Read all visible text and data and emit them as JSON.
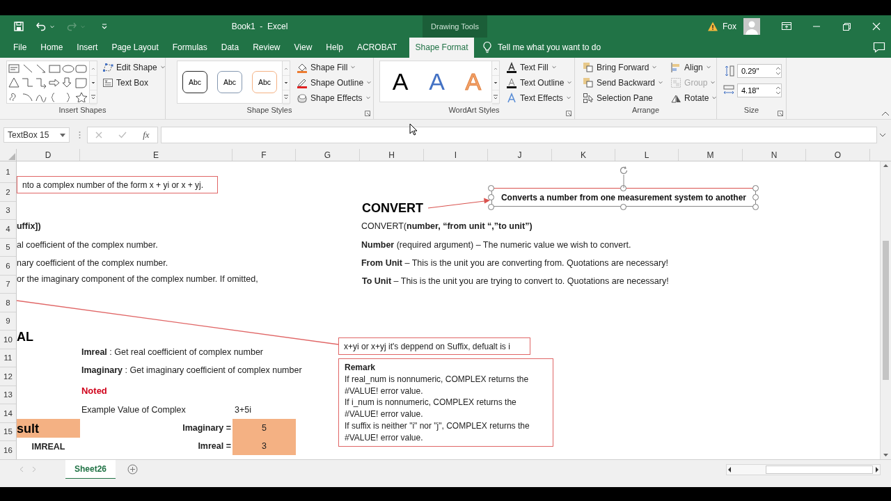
{
  "window": {
    "title": "Book1  -  Excel",
    "context_label": "Drawing Tools",
    "user": "Fox"
  },
  "tabs": [
    {
      "label": "File",
      "selected": false
    },
    {
      "label": "Home",
      "selected": false
    },
    {
      "label": "Insert",
      "selected": false
    },
    {
      "label": "Page Layout",
      "selected": false
    },
    {
      "label": "Formulas",
      "selected": false
    },
    {
      "label": "Data",
      "selected": false
    },
    {
      "label": "Review",
      "selected": false
    },
    {
      "label": "View",
      "selected": false
    },
    {
      "label": "Help",
      "selected": false
    },
    {
      "label": "ACROBAT",
      "selected": false
    },
    {
      "label": "Shape Format",
      "selected": true
    }
  ],
  "tell_me": "Tell me what you want to do",
  "ribbon": {
    "insert_shapes": {
      "title": "Insert Shapes",
      "buttons": [
        "Edit Shape",
        "Text Box"
      ]
    },
    "shape_styles": {
      "title": "Shape Styles",
      "presets": [
        {
          "label": "Abc",
          "color": "#262626"
        },
        {
          "label": "Abc",
          "color": "#8497b0"
        },
        {
          "label": "Abc",
          "color": "#f4b183"
        }
      ],
      "buttons": [
        "Shape Fill",
        "Shape Outline",
        "Shape Effects"
      ]
    },
    "wordart_styles": {
      "title": "WordArt Styles",
      "presets": [
        {
          "label": "A",
          "color": "#000000",
          "kind": "fill"
        },
        {
          "label": "A",
          "color": "#4472c4",
          "kind": "fill"
        },
        {
          "label": "A",
          "color": "#f4a46c",
          "kind": "outline"
        }
      ],
      "buttons": [
        "Text Fill",
        "Text Outline",
        "Text Effects"
      ]
    },
    "arrange": {
      "title": "Arrange",
      "buttons": [
        {
          "label": "Bring Forward",
          "disabled": false
        },
        {
          "label": "Send Backward",
          "disabled": false
        },
        {
          "label": "Selection Pane",
          "disabled": false
        },
        {
          "label": "Align",
          "disabled": false
        },
        {
          "label": "Group",
          "disabled": true
        },
        {
          "label": "Rotate",
          "disabled": false
        }
      ]
    },
    "size": {
      "title": "Size",
      "height": "0.29\"",
      "width": "4.18\""
    }
  },
  "formula_bar": {
    "name_box": "TextBox 15",
    "function_label": "fx"
  },
  "columns": [
    "D",
    "E",
    "F",
    "G",
    "H",
    "I",
    "J",
    "K",
    "L",
    "M",
    "N",
    "O"
  ],
  "rows": [
    "1",
    "2",
    "3",
    "4",
    "5",
    "6",
    "7",
    "8",
    "9",
    "10",
    "11",
    "12",
    "13",
    "14",
    "15",
    "16"
  ],
  "sheet": {
    "items": [
      {
        "kind": "callout",
        "text": "nto a complex number of the form x + yi or x + yj."
      },
      {
        "kind": "text",
        "text": "**uffix])**"
      },
      {
        "kind": "text",
        "text": "al coefficient of the complex number."
      },
      {
        "kind": "text",
        "text": "nary coefficient of the complex number."
      },
      {
        "kind": "text",
        "text": "or the imaginary component of the complex number. If omitted,"
      },
      {
        "kind": "heading",
        "text": "**AL**"
      },
      {
        "kind": "text",
        "text": "**Imreal** : Get real coefficient of complex number"
      },
      {
        "kind": "text",
        "text": "**Imaginary** : Get imaginary coefficient of complex number"
      },
      {
        "kind": "note",
        "text": "**Noted**"
      },
      {
        "kind": "text",
        "text": "Example Value of Complex"
      },
      {
        "kind": "text",
        "text": "3+5i"
      },
      {
        "kind": "filled_heading",
        "text": "**sult**"
      },
      {
        "kind": "header_cell",
        "text": "**IMREAL**"
      },
      {
        "kind": "label",
        "text": "**Imaginary =**"
      },
      {
        "kind": "filled",
        "text": "5"
      },
      {
        "kind": "label",
        "text": "**Imreal =**"
      },
      {
        "kind": "filled",
        "text": "3"
      },
      {
        "kind": "heading",
        "text": "**CONVERT**"
      },
      {
        "kind": "text",
        "text": "CONVERT(**number, “from unit “,”to unit”)**"
      },
      {
        "kind": "text",
        "text": "**Number** (required argument) – The numeric value we wish to convert."
      },
      {
        "kind": "text",
        "text": "**From Unit** – This is the unit you are converting from. Quotations are necessary!"
      },
      {
        "kind": "text",
        "text": "**To Unit** – This is the unit you are trying to convert to. Quotations are necessary!"
      },
      {
        "kind": "selected_box",
        "text": "**Converts a number from one measurement system to another**"
      },
      {
        "kind": "callout",
        "text": "x+yi or x+yj it's deppend on  Suffix, defualt is i"
      },
      {
        "kind": "remark",
        "title": "Remark",
        "lines": [
          "If real_num is nonnumeric, COMPLEX returns the #VALUE! error value.",
          "If i_num is nonnumeric, COMPLEX returns the #VALUE! error value.",
          "If suffix is neither \"i\" nor \"j\", COMPLEX returns the #VALUE! error value."
        ]
      }
    ]
  },
  "sheet_tabs": [
    {
      "label": "Sheet26",
      "selected": true
    }
  ]
}
